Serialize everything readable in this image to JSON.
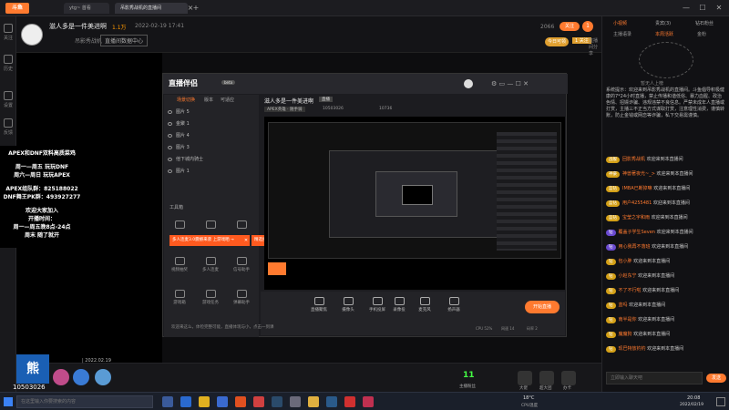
{
  "titlebar": {
    "app_logo": "斗鱼",
    "tab_home": "ytg~ 首看",
    "tab_active": "吊影秀战机的直播间",
    "controls": [
      "—",
      "☐",
      "✕"
    ]
  },
  "left_nav": [
    {
      "icon": "star-icon",
      "label": "关注"
    },
    {
      "icon": "clock-icon",
      "label": "历史"
    },
    {
      "icon": "gear-icon",
      "label": "设置"
    },
    {
      "icon": "feedback-icon",
      "label": "反馈"
    }
  ],
  "header": {
    "title": "滋人多是一件美进啊",
    "views": "1.1万",
    "date": "2022-02-19 17:41",
    "room_tag": "吊影秀战机",
    "tag_btn": "直播间数据中心",
    "hot_count": "2066",
    "follow": "关注",
    "fans": "1",
    "badge": "今日可领",
    "badge2": "1 关注",
    "right": "直播间分享"
  },
  "left_panel": {
    "lines": [
      "APEX和DNF双料高质菜鸡",
      "周一—周五    玩玩DNF",
      "周六—周日    玩玩APEX",
      "APEX组队群：825188022",
      "DNF舞王PK群：493927277",
      "欢迎大家加入",
      "开播时间：",
      "周一—周五晚8点-24点",
      "周末 随了就开"
    ]
  },
  "stream_app": {
    "logo": "直播伴侣",
    "logo_tag": "beta",
    "tabs": [
      "场景切换",
      "版本",
      "可适应"
    ],
    "layers": [
      "图片 5",
      "金聚 1",
      "图片 4",
      "图片 3",
      "他下城内骑士",
      "图片 1"
    ],
    "tools_label": "工具箱",
    "tools": [
      "",
      "",
      "",
      "",
      "",
      "",
      "视频抽奖",
      "多人连麦",
      "信号助手",
      "游戏箱",
      "游戏任务",
      "弹幕助手"
    ],
    "banner1": "多人连麦3.0震撼来袭 上游戏晒 →",
    "banner1_close": "✕",
    "banner2": "精选技师即时体验",
    "banner2_close": "✕",
    "stream_title": "滋人多是一件美进啊",
    "stream_tag": "直播",
    "category": "APEX英雄 · 随手骑",
    "room_id": "10503026",
    "viewers": "10736",
    "footer_note": "欢迎来这么，体检完整可能，直播体现与小，点击一到课",
    "controls": [
      "直播聚焦",
      "摄像头",
      "手机投屏",
      "录像投",
      "麦克风",
      "扬声器"
    ],
    "start_button": "开始直播",
    "stats": [
      "CPU 52%",
      "网速 14",
      "码率 2"
    ]
  },
  "gift_bar": {
    "date_text": "| 2022.02.19",
    "room": "10503026",
    "level_num": "11",
    "level_label": "主播粉丝",
    "gift_labels": [
      "大佬",
      "超大团",
      "办卡"
    ]
  },
  "right_panel": {
    "tabs": [
      "小视频",
      "贵宾(3)",
      "钻石粉丝"
    ],
    "subtabs": [
      "主播语录",
      "本周活跃",
      "金粉"
    ],
    "user": "暂无人上榜",
    "system_note": "系统提示：欢迎来到吊影秀战机的直播间。斗鱼倡导积极健康的7*24小时直播，禁止传播和谐低俗、暴力血腥、政治色情、招嫖诈骗、违规违禁不良信息。严禁未成年人直播或打赏，主播三不正当方式谋取打赏，注意理性消费，谨慎转账，防止金钱或网恋等诈骗，私下交易需谨慎。",
    "chats": [
      {
        "badge": "战舰",
        "user": "回影秀战机",
        "text": "欢迎来到本直播间"
      },
      {
        "badge": "神豪",
        "user": "神兽著夜光~_>",
        "text": "欢迎来到本直播间"
      },
      {
        "badge": "蓝钻",
        "user": "IMBA已断掉嘛",
        "text": "欢迎来到本直播间"
      },
      {
        "badge": "蓝钻",
        "user": "用户4255481",
        "text": "欢迎来到本直播间"
      },
      {
        "badge": "蓝钻",
        "user": "宝莹之宇和雨",
        "text": "欢迎来到本直播间"
      },
      {
        "badge": "钻",
        "user": "覆盖子学生Seven",
        "text": "欢迎来到本直播间"
      },
      {
        "badge": "钻",
        "user": "用心我再不落班",
        "text": "欢迎来到本直播间"
      },
      {
        "badge": "钻",
        "user": "包小胖",
        "text": "欢迎来到本直播间"
      },
      {
        "badge": "钻",
        "user": "小赵东宁",
        "text": "欢迎来到本直播间"
      },
      {
        "badge": "钻",
        "user": "不了不行啦",
        "text": "欢迎来到本直播间"
      },
      {
        "badge": "钻",
        "user": "蓝吗",
        "text": "欢迎来到本直播间"
      },
      {
        "badge": "钻",
        "user": "南半是你",
        "text": "欢迎来到本直播间"
      },
      {
        "badge": "钻",
        "user": "魔魔狗",
        "text": "欢迎来到本直播间"
      },
      {
        "badge": "钻",
        "user": "现巴特放钓钓",
        "text": "欢迎来到本直播间"
      }
    ],
    "input_placeholder": "立即输入聊天吧",
    "send": "发送"
  },
  "taskbar": {
    "search_placeholder": "在这里输入你要搜索的内容",
    "temp": "18°C",
    "weather": "CPU温度",
    "time": "20:08",
    "date": "2022/02/19"
  },
  "colors": {
    "accent": "#ff7a2f",
    "chat_badge": "#d4a017"
  }
}
